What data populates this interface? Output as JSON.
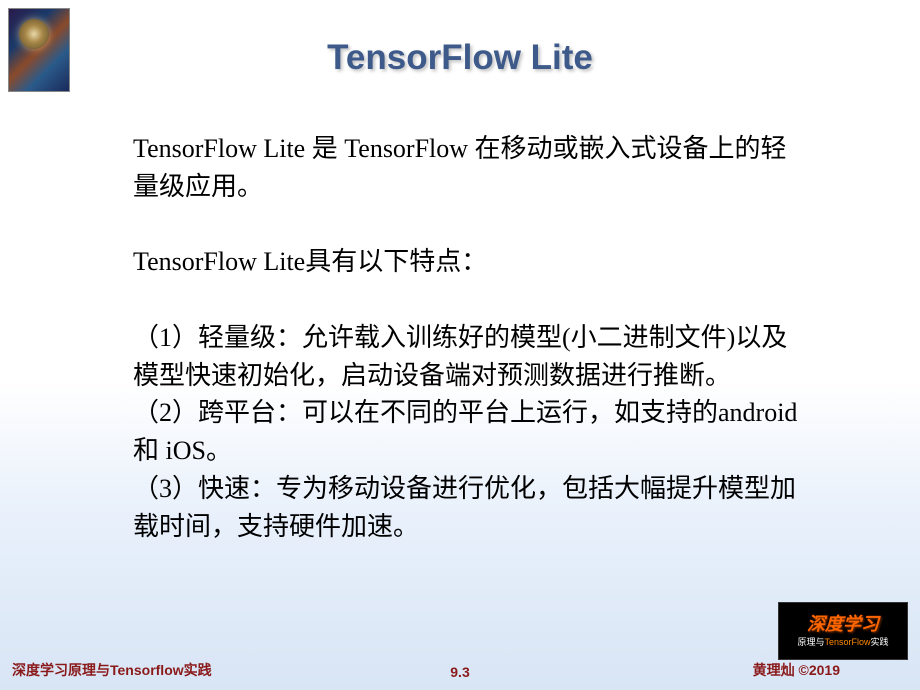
{
  "title": "TensorFlow Lite",
  "intro": "TensorFlow Lite 是 TensorFlow 在移动或嵌入式设备上的轻量级应用。",
  "features_heading": "TensorFlow Lite具有以下特点：",
  "features": [
    "（1）轻量级：允许载入训练好的模型(小二进制文件)以及模型快速初始化，启动设备端对预测数据进行推断。",
    "（2）跨平台：可以在不同的平台上运行，如支持的android和 iOS。",
    "（3）快速：专为移动设备进行优化，包括大幅提升模型加载时间，支持硬件加速。"
  ],
  "footer": {
    "left": "深度学习原理与Tensorflow实践",
    "center": "9.3",
    "right": "黄理灿 ©2019"
  },
  "book": {
    "main": "深度学习",
    "sub_prefix": "原理与",
    "sub_tf": "TensorFlow",
    "sub_suffix": "实践"
  }
}
